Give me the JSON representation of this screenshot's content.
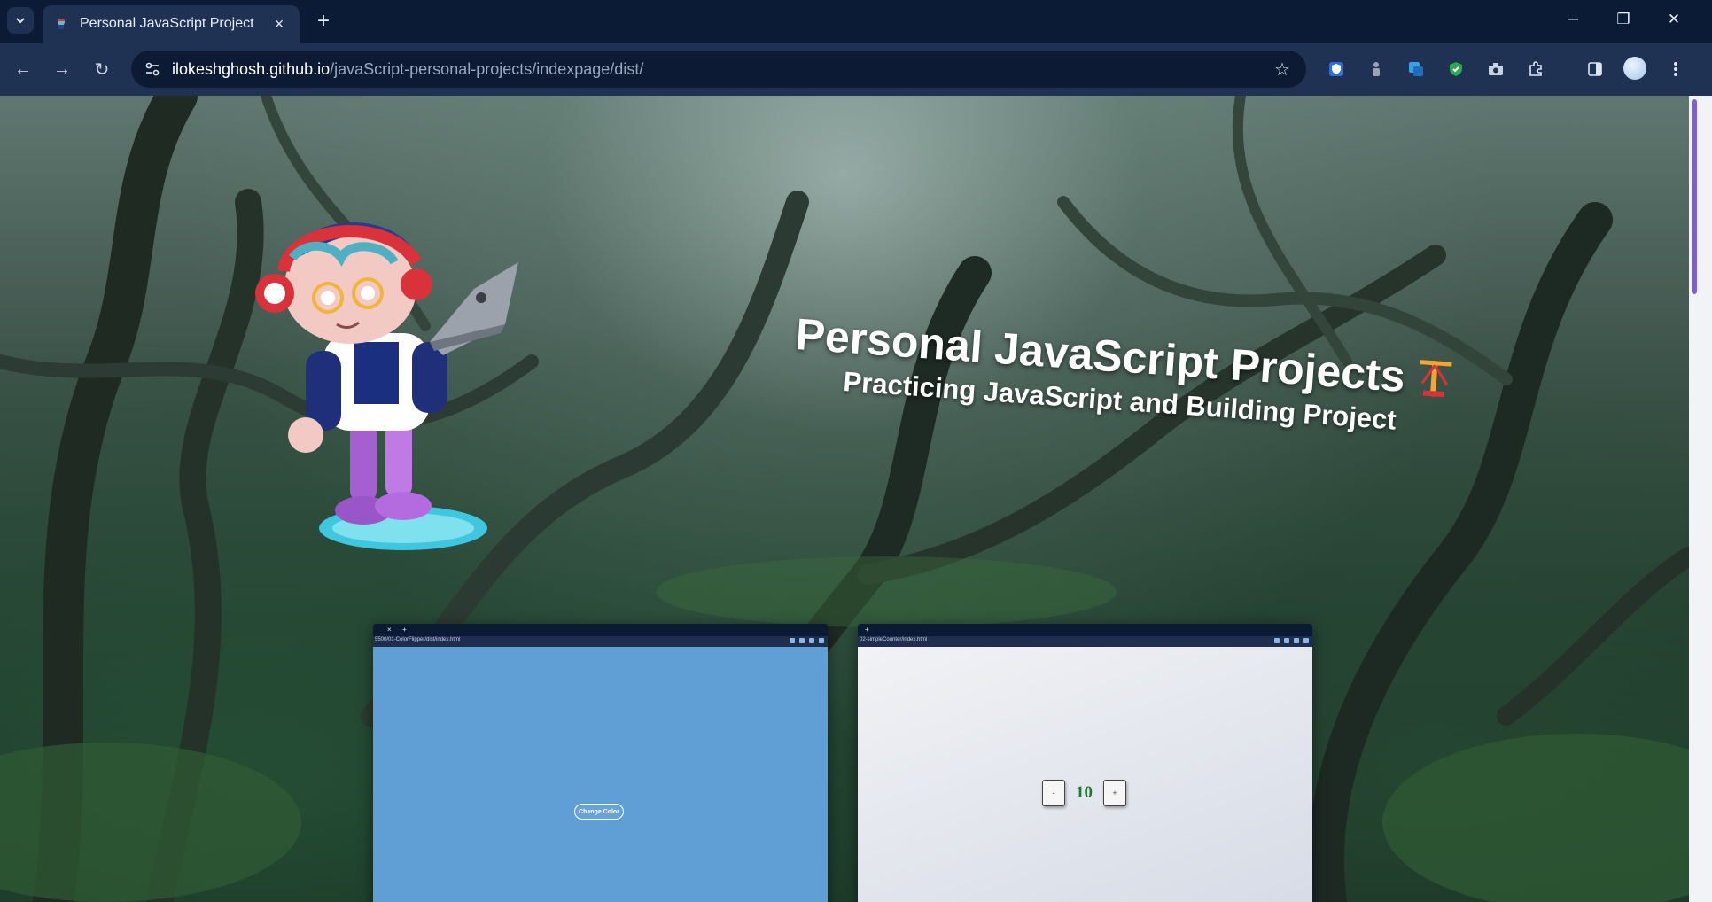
{
  "browser": {
    "tab": {
      "title": "Personal JavaScript Project",
      "favicon": "octocat-favicon"
    },
    "address": {
      "host": "ilokeshghosh.github.io",
      "path": "/javaScript-personal-projects/indexpage/dist/"
    },
    "icons": {
      "tab_search": "chevron-down",
      "close": "×",
      "new_tab": "+",
      "minimize": "─",
      "restore": "❐",
      "close_window": "✕",
      "back": "←",
      "forward": "→",
      "reload": "↻",
      "site_info": "⚙",
      "bookmark": "☆"
    }
  },
  "page": {
    "title": "Personal JavaScript Projects",
    "title_icon": "crane-icon",
    "subtitle": "Practicing JavaScript and Building Project"
  },
  "cards": [
    {
      "name": "color-flipper",
      "mini_url": "5500/01-ColorFlipper/dist/index.html",
      "button_label": "Change Color",
      "bg_color": "#5f9fd6"
    },
    {
      "name": "counter",
      "mini_url": "02-simpleCounter/index.html",
      "decrement": "-",
      "value": "10",
      "increment": "+"
    }
  ],
  "colors": {
    "chrome_dark": "#0b1a35",
    "chrome": "#203254",
    "value_green": "#1d7a2f"
  }
}
